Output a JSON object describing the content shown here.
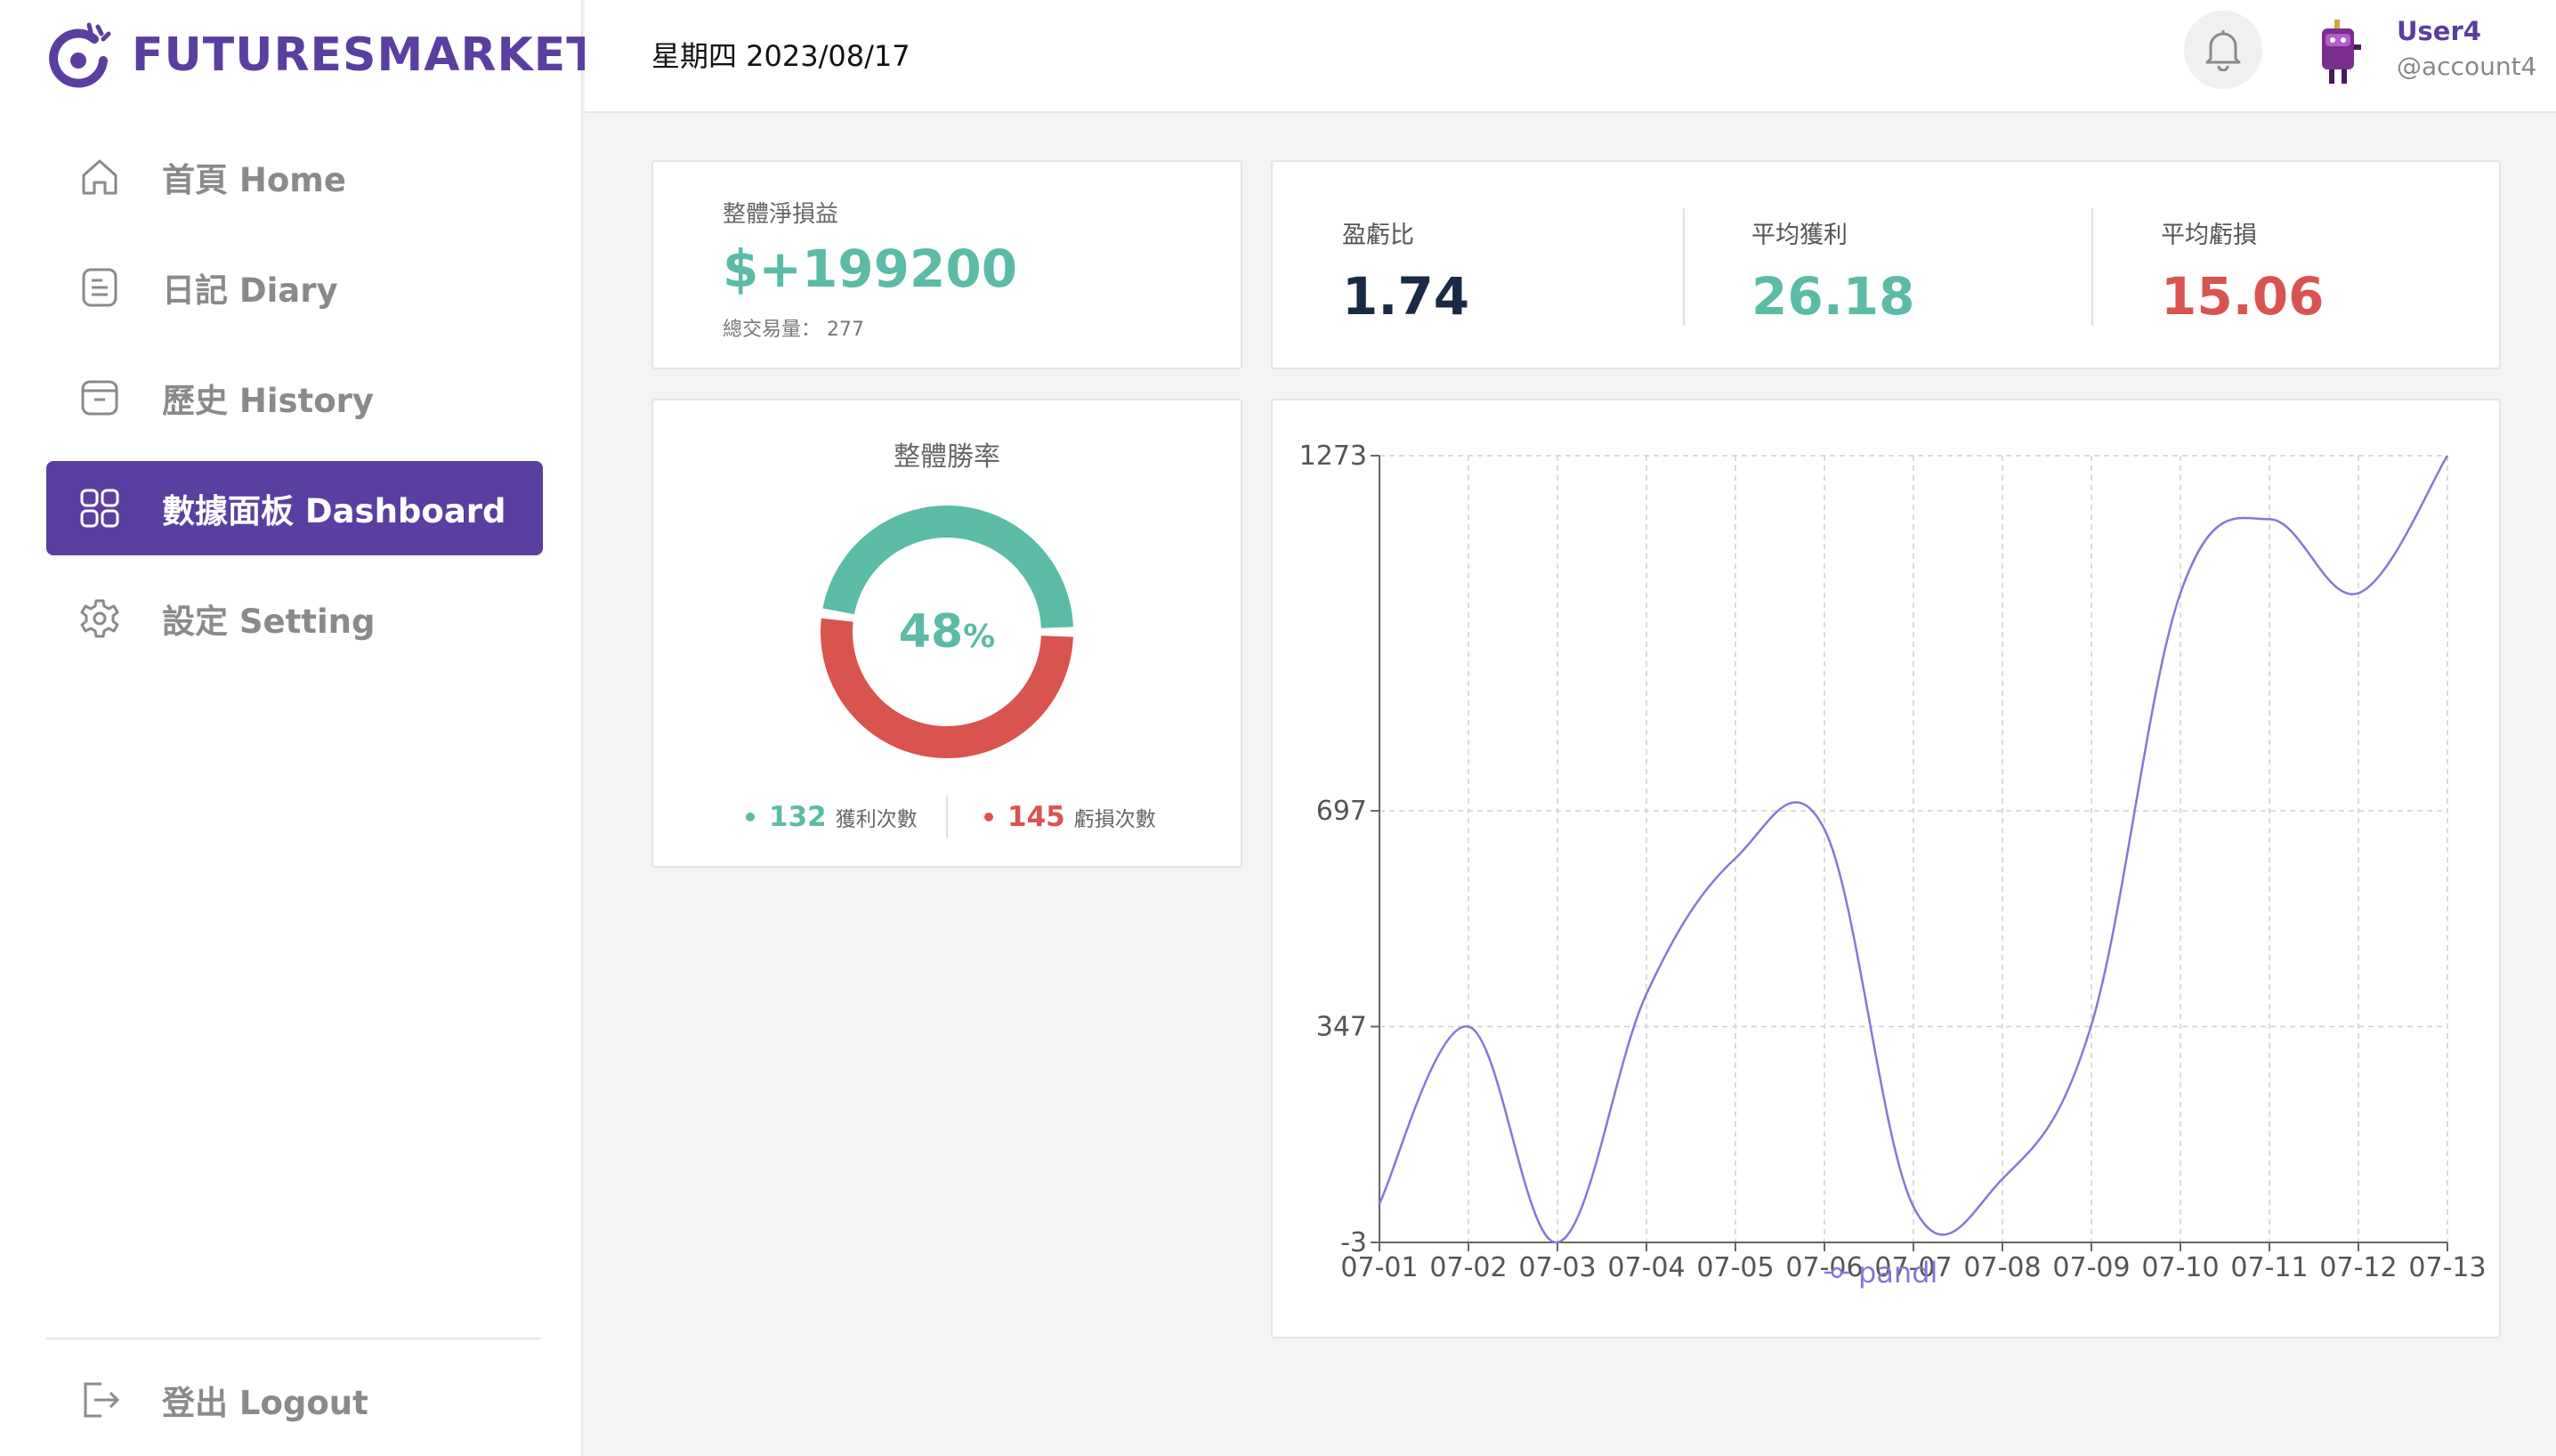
{
  "brand": {
    "name": "FUTURESMARKET",
    "color": "#5a3fa0"
  },
  "sidebar": {
    "items": [
      {
        "label": "首頁  Home",
        "icon": "home-icon",
        "active": false
      },
      {
        "label": "日記  Diary",
        "icon": "document-icon",
        "active": false
      },
      {
        "label": "歷史  History",
        "icon": "archive-icon",
        "active": false
      },
      {
        "label": "數據面板  Dashboard",
        "icon": "grid-icon",
        "active": true
      },
      {
        "label": "設定  Setting",
        "icon": "gear-icon",
        "active": false
      }
    ],
    "logout_label": "登出  Logout"
  },
  "header": {
    "date": "星期四 2023/08/17",
    "username": "User4",
    "handle": "@account4"
  },
  "summary": {
    "net_label": "整體淨損益",
    "net_value": "$+199200",
    "trades_label": "總交易量：  277"
  },
  "ratios": {
    "ratio_label": "盈虧比",
    "ratio_value": "1.74",
    "avg_profit_label": "平均獲利",
    "avg_profit_value": "26.18",
    "avg_loss_label": "平均虧損",
    "avg_loss_value": "15.06"
  },
  "winrate": {
    "title": "整體勝率",
    "percent": "48",
    "percent_sign": "%",
    "wins": "132",
    "wins_label": "獲利次數",
    "losses": "145",
    "losses_label": "虧損次數",
    "win_color": "#5bbba6",
    "loss_color": "#d9534f"
  },
  "chart_data": {
    "type": "line",
    "categories": [
      "07-01",
      "07-02",
      "07-03",
      "07-04",
      "07-05",
      "07-06",
      "07-07",
      "07-08",
      "07-09",
      "07-10",
      "07-11",
      "07-12",
      "07-13"
    ],
    "series": [
      {
        "name": "pandl",
        "values": [
          60,
          347,
          -3,
          400,
          620,
          667,
          55,
          100,
          350,
          1050,
          1170,
          1050,
          1273
        ]
      }
    ],
    "yticks": [
      -3,
      347,
      697,
      1273
    ],
    "ylim": [
      -3,
      1273
    ],
    "grid": true,
    "legend": "bottom-center",
    "line_color": "#8478d6"
  }
}
